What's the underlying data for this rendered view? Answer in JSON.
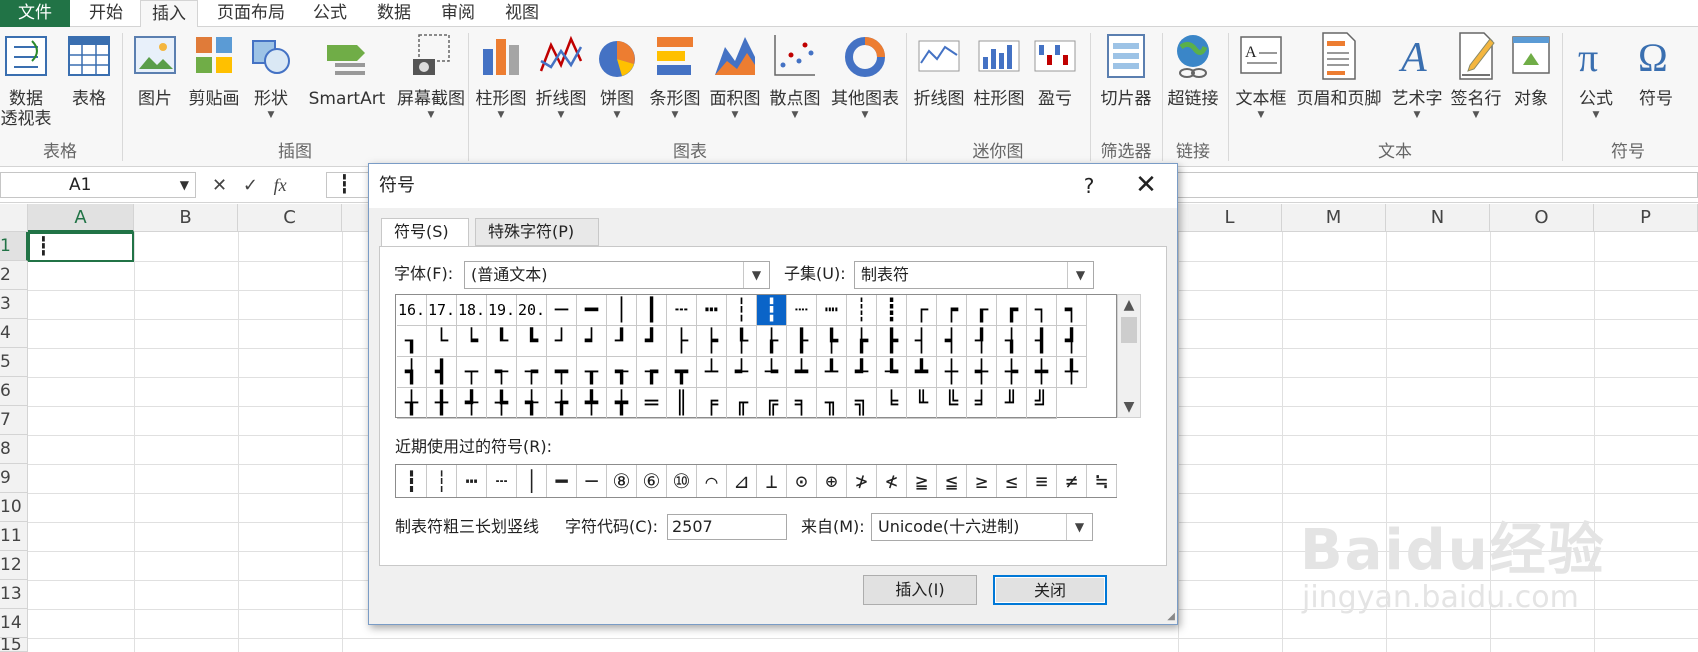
{
  "tabs": [
    "文件",
    "开始",
    "插入",
    "页面布局",
    "公式",
    "数据",
    "审阅",
    "视图"
  ],
  "ribbon": {
    "buttons": [
      {
        "label": "数据",
        "label2": "透视表",
        "icon": "pivot-table-icon"
      },
      {
        "label": "表格",
        "icon": "table-icon"
      },
      {
        "label": "图片",
        "icon": "picture-icon"
      },
      {
        "label": "剪贴画",
        "icon": "clipart-icon"
      },
      {
        "label": "形状",
        "icon": "shapes-icon"
      },
      {
        "label": "SmartArt",
        "icon": "smartart-icon"
      },
      {
        "label": "屏幕截图",
        "icon": "screenshot-icon"
      },
      {
        "label": "柱形图",
        "icon": "column-chart-icon"
      },
      {
        "label": "折线图",
        "icon": "line-chart-icon"
      },
      {
        "label": "饼图",
        "icon": "pie-chart-icon"
      },
      {
        "label": "条形图",
        "icon": "bar-chart-icon"
      },
      {
        "label": "面积图",
        "icon": "area-chart-icon"
      },
      {
        "label": "散点图",
        "icon": "scatter-chart-icon"
      },
      {
        "label": "其他图表",
        "icon": "other-charts-icon"
      },
      {
        "label": "折线图",
        "icon": "sparkline-line-icon"
      },
      {
        "label": "柱形图",
        "icon": "sparkline-column-icon"
      },
      {
        "label": "盈亏",
        "icon": "sparkline-winloss-icon"
      },
      {
        "label": "切片器",
        "icon": "slicer-icon"
      },
      {
        "label": "超链接",
        "icon": "hyperlink-icon"
      },
      {
        "label": "文本框",
        "icon": "textbox-icon"
      },
      {
        "label": "页眉和页脚",
        "icon": "header-footer-icon"
      },
      {
        "label": "艺术字",
        "icon": "wordart-icon"
      },
      {
        "label": "签名行",
        "icon": "signature-line-icon"
      },
      {
        "label": "对象",
        "icon": "object-icon"
      },
      {
        "label": "公式",
        "icon": "equation-icon"
      },
      {
        "label": "符号",
        "icon": "symbol-icon"
      }
    ],
    "groups": [
      "表格",
      "插图",
      "图表",
      "迷你图",
      "筛选器",
      "链接",
      "文本",
      "符号"
    ]
  },
  "formula": {
    "namebox": "A1",
    "cancel": "✕",
    "enter": "✓",
    "fx": "fx",
    "content": "┇"
  },
  "grid": {
    "cols": [
      "A",
      "B",
      "C",
      "L",
      "M",
      "N",
      "O",
      "P"
    ],
    "rows": [
      "1",
      "2",
      "3",
      "4",
      "5",
      "6",
      "7",
      "8",
      "9",
      "10",
      "11",
      "12",
      "13",
      "14",
      "15"
    ],
    "a1_value": "┇"
  },
  "dialog": {
    "title": "符号",
    "help": "?",
    "close": "✕",
    "tab_symbols": "符号(S)",
    "tab_special": "特殊字符(P)",
    "font_label": "字体(F):",
    "font_value": "(普通文本)",
    "subset_label": "子集(U):",
    "subset_value": "制表符",
    "symbols": [
      "16.",
      "17.",
      "18.",
      "19.",
      "20.",
      "─",
      "━",
      "│",
      "┃",
      "┄",
      "┅",
      "┆",
      "┇",
      "┈",
      "┉",
      "┊",
      "┋",
      "┌",
      "┍",
      "┎",
      "┏",
      "┐",
      "┑",
      "┒",
      "└",
      "┕",
      "┖",
      "┗",
      "┘",
      "┙",
      "┚",
      "┛",
      "├",
      "┝",
      "┞",
      "┟",
      "┠",
      "┡",
      "┢",
      "┣",
      "┤",
      "┥",
      "┦",
      "┧",
      "┨",
      "┩",
      "┪",
      "┫",
      "┬",
      "┭",
      "┮",
      "┯",
      "┰",
      "┱",
      "┲",
      "┳",
      "┴",
      "┵",
      "┶",
      "┷",
      "┸",
      "┹",
      "┺",
      "┻",
      "┼",
      "┽",
      "┾",
      "┿",
      "╀",
      "╁",
      "╂",
      "╃",
      "╄",
      "╅",
      "╆",
      "╇",
      "╈",
      "═",
      "║",
      "╒",
      "╓",
      "╔",
      "╕",
      "╖",
      "╗",
      "╘",
      "╙",
      "╚",
      "╛",
      "╜",
      "╝"
    ],
    "selected_index": 12,
    "recent_label": "近期使用过的符号(R):",
    "recent": [
      "┇",
      "┆",
      "┅",
      "┄",
      "│",
      "━",
      "─",
      "⑧",
      "⑥",
      "⑩",
      "⌒",
      "⊿",
      "⊥",
      "⊙",
      "⊕",
      "≯",
      "≮",
      "≧",
      "≦",
      "≥",
      "≤",
      "≡",
      "≠",
      "≒"
    ],
    "char_name": "制表符粗三长划竖线",
    "code_label": "字符代码(C):",
    "code_value": "2507",
    "from_label": "来自(M):",
    "from_value": "Unicode(十六进制)",
    "insert_button": "插入(I)",
    "close_button": "关闭"
  },
  "watermark": {
    "brand": "Baidu经验",
    "url": "jingyan.baidu.com"
  },
  "colors": {
    "excel_green": "#217346",
    "selection_blue": "#0a64c8",
    "accent": "#0078d7"
  }
}
